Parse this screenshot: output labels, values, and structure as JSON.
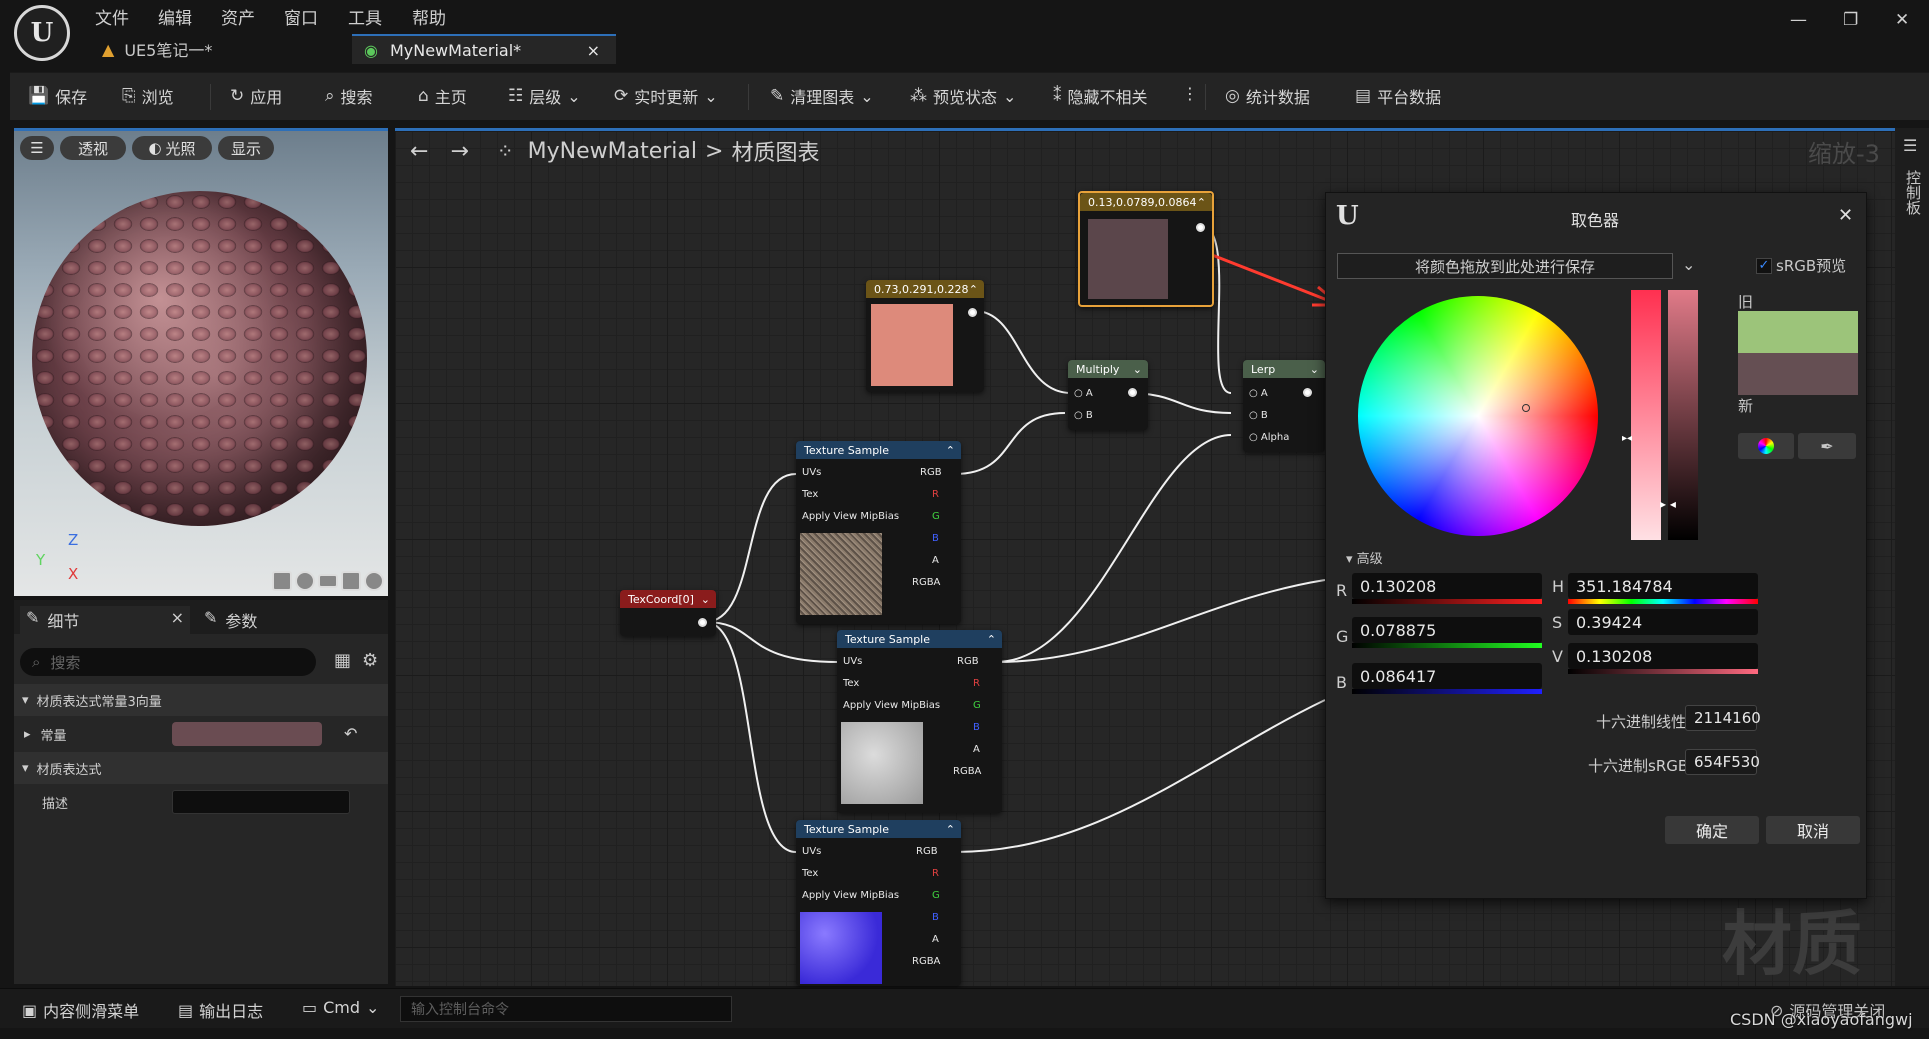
{
  "menu": [
    "文件",
    "编辑",
    "资产",
    "窗口",
    "工具",
    "帮助"
  ],
  "tabs": [
    {
      "label": "UE5笔记一*"
    },
    {
      "label": "MyNewMaterial*",
      "close": "×"
    }
  ],
  "window_controls": [
    "—",
    "❐",
    "✕"
  ],
  "toolbar": {
    "save": "保存",
    "browse": "浏览",
    "apply": "应用",
    "search": "搜索",
    "home": "主页",
    "hierarchy": "层级",
    "live_update": "实时更新",
    "clean_graph": "清理图表",
    "preview_state": "预览状态",
    "hide_unrelated": "隐藏不相关",
    "more": "⋮",
    "stats": "统计数据",
    "platform_stats": "平台数据"
  },
  "viewport": {
    "perspective": "透视",
    "lit": "光照",
    "show": "显示",
    "axis_z": "Z",
    "axis_y": "Y",
    "axis_x": "X"
  },
  "details": {
    "tab_details": "细节",
    "tab_params": "参数",
    "close": "×",
    "search_placeholder": "搜索",
    "cat_vector": "材质表达式常量3向量",
    "prop_constant": "常量",
    "cat_expression": "材质表达式",
    "prop_desc": "描述",
    "constant_color": "#6a4c52"
  },
  "graph": {
    "breadcrumb_asset": "MyNewMaterial",
    "breadcrumb_sep": ">",
    "breadcrumb_graph": "材质图表",
    "zoom": "缩放-3",
    "watermark": "材质"
  },
  "nodes": {
    "const_selected": {
      "title": "0.13,0.0789,0.0864",
      "color": "#5b464b"
    },
    "const_peach": {
      "title": "0.73,0.291,0.228",
      "color": "#dd8a7b"
    },
    "multiply": {
      "title": "Multiply",
      "pins": [
        "A",
        "B"
      ]
    },
    "lerp": {
      "title": "Lerp",
      "pins": [
        "A",
        "B",
        "Alpha"
      ]
    },
    "texcoord": {
      "title": "TexCoord[0]"
    },
    "texture_sample_pins_in": [
      "UVs",
      "Tex",
      "Apply View MipBias"
    ],
    "texture_sample_pins_out": [
      "RGB",
      "R",
      "G",
      "B",
      "A",
      "RGBA"
    ],
    "texture_sample_title": "Texture Sample"
  },
  "color_picker": {
    "title": "取色器",
    "close": "✕",
    "save_drop": "将颜色拖放到此处进行保存",
    "srgb_preview": "sRGB预览",
    "old_label": "旧",
    "new_label": "新",
    "old_color": "#9cc47a",
    "new_color": "#654f53",
    "advanced": "高级",
    "r_label": "R",
    "r_value": "0.130208",
    "g_label": "G",
    "g_value": "0.078875",
    "b_label": "B",
    "b_value": "0.086417",
    "h_label": "H",
    "h_value": "351.184784",
    "s_label": "S",
    "s_value": "0.39424",
    "v_label": "V",
    "v_value": "0.130208",
    "hex_linear_label": "十六进制线性",
    "hex_linear": "2114160",
    "hex_srgb_label": "十六进制sRGB",
    "hex_srgb": "654F530",
    "ok": "确定",
    "cancel": "取消"
  },
  "side_panel": {
    "label": "控制板"
  },
  "bottom": {
    "content_drawer": "内容侧滑菜单",
    "output_log": "输出日志",
    "cmd": "Cmd",
    "cmd_placeholder": "输入控制台命令",
    "source_control": "源码管理关闭",
    "credit": "CSDN @xiaoyaofangwj"
  }
}
